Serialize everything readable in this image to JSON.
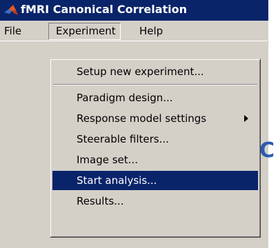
{
  "window": {
    "title": "fMRI Canonical Correlation",
    "icon": "matlab-logo-icon"
  },
  "menubar": {
    "items": [
      {
        "label": "File"
      },
      {
        "label": "Experiment"
      },
      {
        "label": "Help"
      }
    ]
  },
  "background": {
    "partial_text": "C"
  },
  "experiment_menu": {
    "items": [
      {
        "label": "Setup new experiment...",
        "selected": false
      },
      {
        "label": "Paradigm design...",
        "selected": false
      },
      {
        "label": "Response model settings",
        "selected": false,
        "submenu": true
      },
      {
        "label": "Steerable filters...",
        "selected": false
      },
      {
        "label": "Image set...",
        "selected": false
      },
      {
        "label": "Start analysis...",
        "selected": true
      },
      {
        "label": "Results...",
        "selected": false
      }
    ]
  },
  "colors": {
    "titlebar": "#0a246a",
    "selection": "#0a246a",
    "face": "#d4d0c8"
  }
}
